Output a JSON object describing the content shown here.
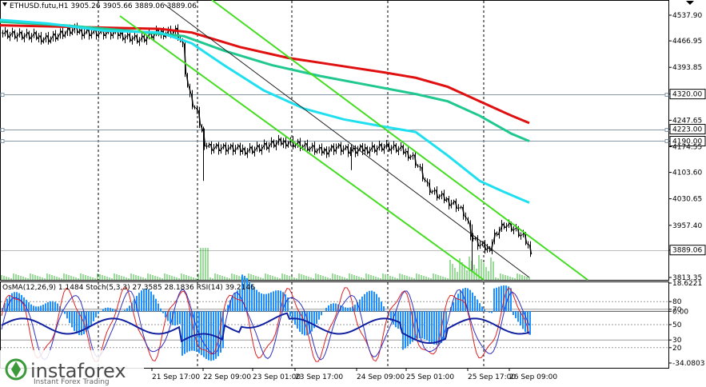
{
  "chart_title": "ETHUSD.futu,H1  3905.26 3905.66 3889.06 3889.06",
  "price_axis": {
    "ticks": [
      "4537.90",
      "4466.95",
      "4393.85",
      "4320.00",
      "4247.65",
      "4223.00",
      "4190.00",
      "4174.55",
      "4103.60",
      "4030.65",
      "3957.40",
      "3889.06",
      "3813.35"
    ],
    "current_price": "3889.06"
  },
  "level_lines": [
    {
      "label": "4320.00",
      "value": 4320.0
    },
    {
      "label": "4223.00",
      "value": 4223.0
    },
    {
      "label": "4190.00",
      "value": 4190.0
    }
  ],
  "osc_header": "OsMA(12,26,9) 1.1484  Stoch(5,3,3) 27.3585 28.1836  RSI(14) 39.2146",
  "osc_axis": {
    "ticks": [
      "18.6221",
      "80",
      "70",
      "0.00",
      "50",
      "30",
      "20",
      "-34.0803"
    ]
  },
  "time_axis": [
    "21 Sep 17:00",
    "22 Sep 09:00",
    "23 Sep 01:00",
    "23 Sep 17:00",
    "24 Sep 09:00",
    "25 Sep 01:00",
    "25 Sep 17:00",
    "26 Sep 09:00"
  ],
  "watermark": {
    "brand": "instaforex",
    "tagline": "Instant Forex Trading"
  },
  "colors": {
    "ma_red": "#e01010",
    "ma_green": "#20c890",
    "ma_cyan": "#20e0f0",
    "channel": "#44dd22",
    "histogram": "#1e90ff",
    "stoch_main": "#3030c0",
    "stoch_signal": "#e02020",
    "rsi": "#1020a0"
  }
}
